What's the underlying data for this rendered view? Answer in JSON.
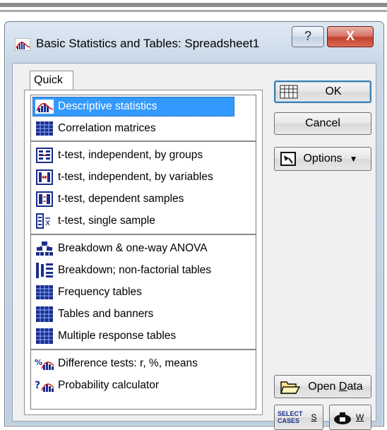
{
  "window": {
    "title": "Basic Statistics and Tables: Spreadsheet1",
    "help_label": "?",
    "close_label": "X"
  },
  "tabs": [
    {
      "label": "Quick"
    }
  ],
  "list": {
    "items": [
      {
        "label": "Descriptive statistics",
        "icon": "descriptive-stats-icon",
        "selected": true
      },
      {
        "label": "Correlation matrices",
        "icon": "correlation-matrix-icon"
      },
      {
        "label": "t-test, independent, by groups",
        "icon": "ttest-groups-icon"
      },
      {
        "label": "t-test, independent, by variables",
        "icon": "ttest-variables-icon"
      },
      {
        "label": "t-test, dependent samples",
        "icon": "ttest-dependent-icon"
      },
      {
        "label": "t-test, single sample",
        "icon": "ttest-single-icon"
      },
      {
        "label": "Breakdown & one-way ANOVA",
        "icon": "breakdown-anova-icon"
      },
      {
        "label": "Breakdown; non-factorial tables",
        "icon": "breakdown-nonfactorial-icon"
      },
      {
        "label": "Frequency tables",
        "icon": "frequency-table-icon"
      },
      {
        "label": "Tables and banners",
        "icon": "tables-banners-icon"
      },
      {
        "label": "Multiple response tables",
        "icon": "multiple-response-icon"
      },
      {
        "label": "Difference tests: r, %, means",
        "icon": "difference-tests-icon"
      },
      {
        "label": "Probability calculator",
        "icon": "probability-calculator-icon"
      }
    ]
  },
  "buttons": {
    "ok": "OK",
    "cancel": "Cancel",
    "options": "Options",
    "open_data_pre": "Open ",
    "open_data_ul": "D",
    "open_data_post": "ata",
    "select_cases_line1": "SELECT",
    "select_cases_line2": "CASES",
    "select_cases_key": "S",
    "weights_key": "W"
  },
  "colors": {
    "selection": "#3399ff",
    "title_bar": "#c9d8e8",
    "close_button": "#c1412f"
  }
}
